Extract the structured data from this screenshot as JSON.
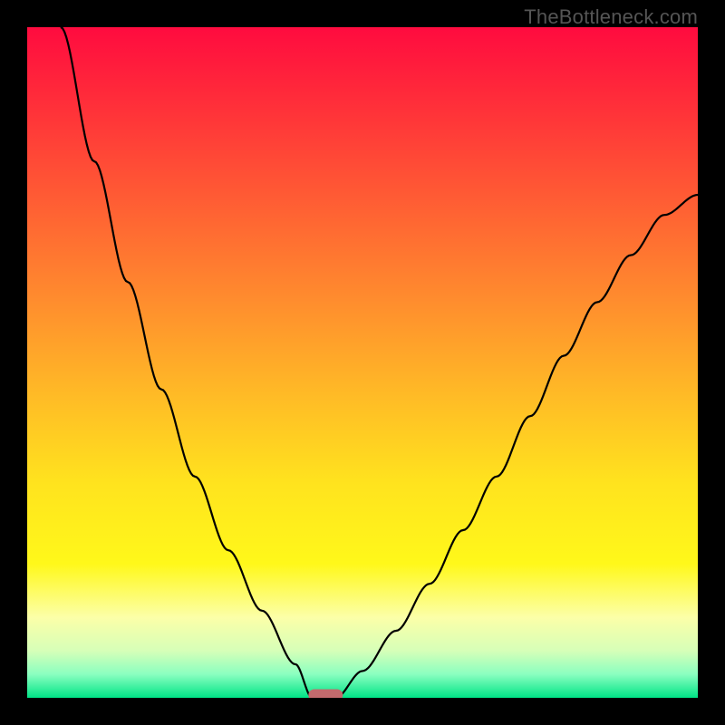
{
  "watermark": "TheBottleneck.com",
  "colors": {
    "gradient_stops": [
      {
        "offset": 0.0,
        "color": "#ff0b3f"
      },
      {
        "offset": 0.1,
        "color": "#ff2a3a"
      },
      {
        "offset": 0.25,
        "color": "#ff5a34"
      },
      {
        "offset": 0.4,
        "color": "#ff8a2e"
      },
      {
        "offset": 0.55,
        "color": "#ffbb26"
      },
      {
        "offset": 0.68,
        "color": "#ffe31e"
      },
      {
        "offset": 0.8,
        "color": "#fff81a"
      },
      {
        "offset": 0.88,
        "color": "#fcffa8"
      },
      {
        "offset": 0.93,
        "color": "#d6ffb8"
      },
      {
        "offset": 0.965,
        "color": "#8affc0"
      },
      {
        "offset": 1.0,
        "color": "#00e486"
      }
    ],
    "curve": "#000000",
    "marker_fill": "#c26a6d",
    "marker_stroke": "#c26a6d",
    "frame": "#000000"
  },
  "chart_data": {
    "type": "line",
    "title": "",
    "xlabel": "",
    "ylabel": "",
    "xlim": [
      0,
      100
    ],
    "ylim": [
      0,
      100
    ],
    "grid": false,
    "legend": false,
    "description": "Bottleneck-style V-curve; y≈0 at the optimal x, rising steeply on both sides. Background is a vertical gradient (red→orange→yellow→green) indicating quality from bad (top) to good (bottom).",
    "series": [
      {
        "name": "left-branch",
        "x": [
          5,
          10,
          15,
          20,
          25,
          30,
          35,
          40,
          42.5
        ],
        "y": [
          100,
          80,
          62,
          46,
          33,
          22,
          13,
          5,
          0
        ]
      },
      {
        "name": "right-branch",
        "x": [
          46,
          50,
          55,
          60,
          65,
          70,
          75,
          80,
          85,
          90,
          95,
          100
        ],
        "y": [
          0,
          4,
          10,
          17,
          25,
          33,
          42,
          51,
          59,
          66,
          72,
          75
        ]
      }
    ],
    "marker": {
      "name": "optimal-range",
      "x_center": 44.5,
      "width": 5,
      "y": 0
    }
  }
}
